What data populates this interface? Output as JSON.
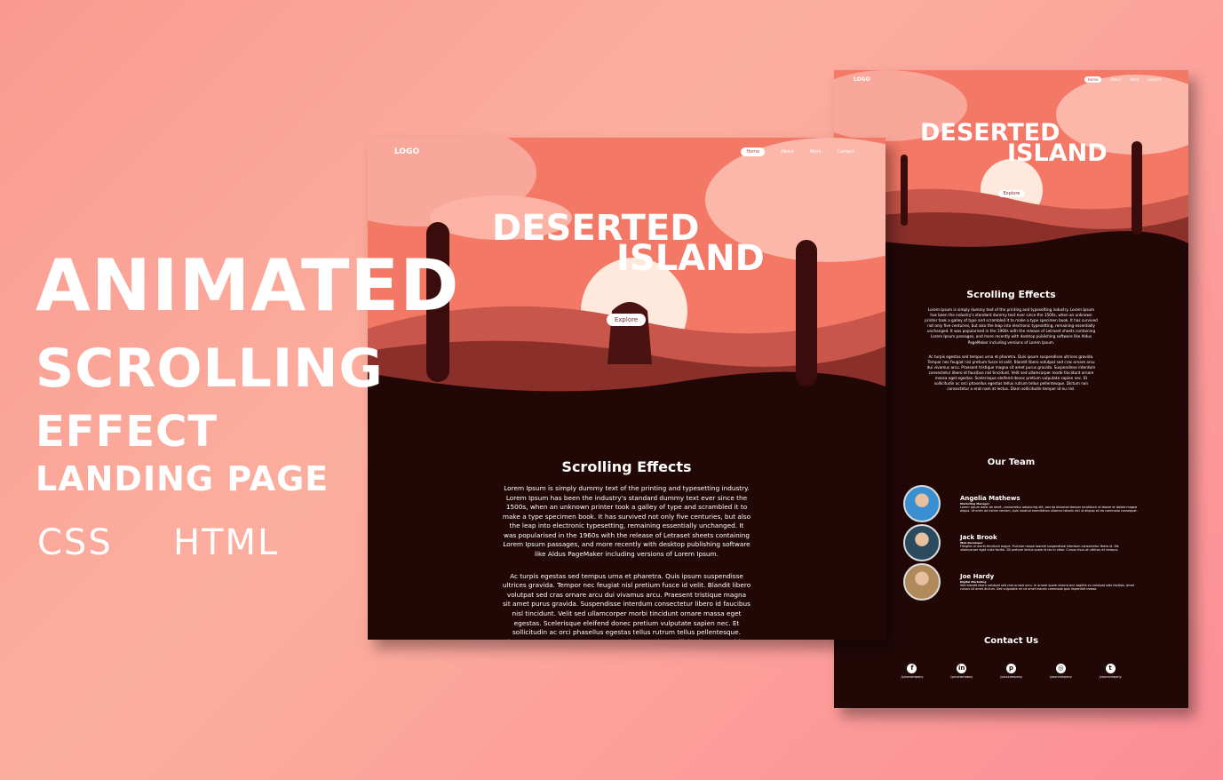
{
  "headline": {
    "line1": "ANIMATED",
    "line2": "SCROLLING",
    "line3": "EFFECT",
    "line4": "LANDING PAGE",
    "tag1": "CSS",
    "tag2": "HTML"
  },
  "site": {
    "logo": "LOGO",
    "nav": [
      "Home",
      "About",
      "Work",
      "Contact"
    ],
    "hero_title_1": "DESERTED",
    "hero_title_2": "ISLAND",
    "explore": "Explore",
    "section_title": "Scrolling Effects",
    "para1": "Lorem Ipsum is simply dummy text of the printing and typesetting industry. Lorem Ipsum has been the industry's standard dummy text ever since the 1500s, when an unknown printer took a galley of type and scrambled it to make a type specimen book. It has survived not only five centuries, but also the leap into electronic typesetting, remaining essentially unchanged. It was popularised in the 1960s with the release of Letraset sheets containing Lorem Ipsum passages, and more recently with desktop publishing software like Aldus PageMaker including versions of Lorem Ipsum.",
    "para2": "Ac turpis egestas sed tempus urna et pharetra. Quis ipsum suspendisse ultrices gravida. Tempor nec feugiat nisl pretium fusce id velit. Blandit libero volutpat sed cras ornare arcu dui vivamus arcu. Praesent tristique magna sit amet purus gravida. Suspendisse interdum consectetur libero id faucibus nisl tincidunt. Velit sed ullamcorper morbi tincidunt ornare massa eget egestas. Scelerisque eleifend donec pretium vulputate sapien nec. Et sollicitudin ac orci phasellus egestas tellus rutrum tellus pellentesque. Dictum non consectetur a erat nam at lectus. Diam sollicitudin tempor id eu nisl.",
    "team_title": "Our Team",
    "team": [
      {
        "name": "Angelia Mathews",
        "role": "Marketing Manager",
        "desc": "Lorem ipsum dolor sit amet, consectetur adipiscing elit, sed do eiusmod tempor incididunt ut labore et dolore magna aliqua. Ut enim ad minim veniam, quis nostrud exercitation ullamco laboris nisi ut aliquip ex ea commodo consequat.",
        "color": "#3a8fd0"
      },
      {
        "name": "Jack Brook",
        "role": "Web Developer",
        "desc": "Fringilla ut morbi tincidunt augue. Pulvinar neque laoreet suspendisse interdum consectetur libero id. Est ullamcorper eget nulla facilisi. Sit pretium lectus quam id leo in vitae. Cursus risus at ultrices mi tempus.",
        "color": "#2b4a5e"
      },
      {
        "name": "Joe Hardy",
        "role": "Digital Marketing",
        "desc": "Sed blandit libero volutpat sed cras ornare arcu. In ornare quam viverra orci sagittis eu volutpat odio facilisis. Amet cursus sit amet dictum. Sed vulputate mi sit amet mauris commodo quis imperdiet massa.",
        "color": "#b08a5a"
      }
    ],
    "contact_title": "Contact Us",
    "social": [
      {
        "icon": "facebook-icon",
        "glyph": "f",
        "handle": "/yourcompany"
      },
      {
        "icon": "linkedin-icon",
        "glyph": "in",
        "handle": "/yourcompany"
      },
      {
        "icon": "pinterest-icon",
        "glyph": "p",
        "handle": "/yourcompany"
      },
      {
        "icon": "instagram-icon",
        "glyph": "◎",
        "handle": "/yourcompany"
      },
      {
        "icon": "twitter-icon",
        "glyph": "t",
        "handle": "/yourcompany"
      }
    ]
  },
  "colors": {
    "bg": "#220707",
    "sky": "#f77a6a",
    "accent": "#ffffff"
  }
}
